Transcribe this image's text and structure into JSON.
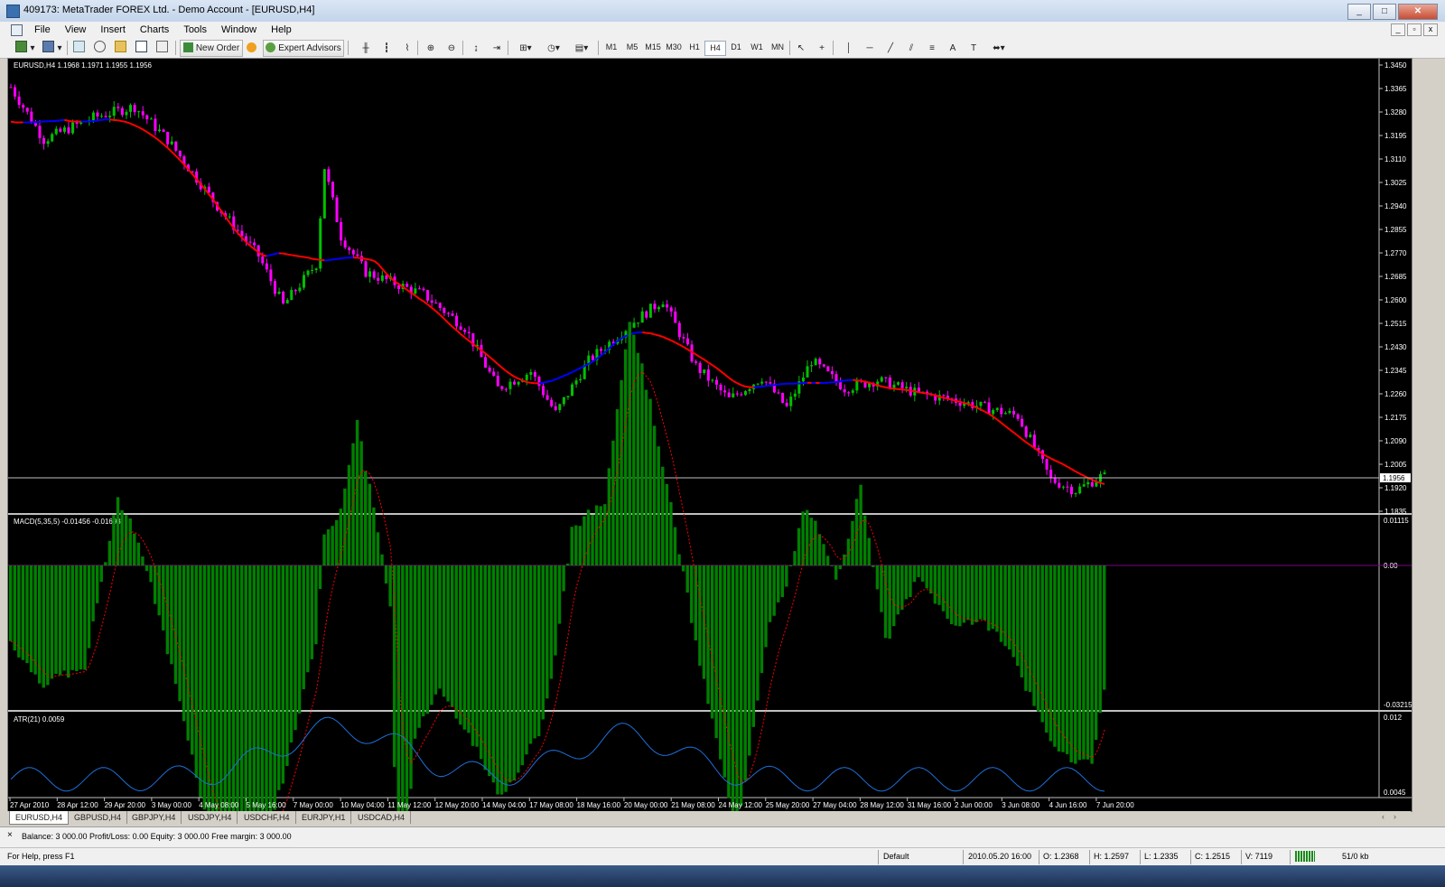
{
  "window": {
    "title": "409173: MetaTrader FOREX Ltd. - Demo Account - [EURUSD,H4]",
    "min": "_",
    "max": "□",
    "close": "✕"
  },
  "menu": [
    "File",
    "View",
    "Insert",
    "Charts",
    "Tools",
    "Window",
    "Help"
  ],
  "toolbar": {
    "new_order": "New Order",
    "expert_advisors": "Expert Advisors",
    "timeframes": [
      "M1",
      "M5",
      "M15",
      "M30",
      "H1",
      "H4",
      "D1",
      "W1",
      "MN"
    ],
    "selected_timeframe": "H4",
    "text_tool": "A",
    "label_tool": "T"
  },
  "chart": {
    "header": "EURUSD,H4  1.1968 1.1971 1.1955 1.1956",
    "price_axis": [
      "1.3450",
      "1.3365",
      "1.3280",
      "1.3195",
      "1.3110",
      "1.3025",
      "1.2940",
      "1.2855",
      "1.2770",
      "1.2685",
      "1.2600",
      "1.2515",
      "1.2430",
      "1.2345",
      "1.2260",
      "1.2175",
      "1.2090",
      "1.2005",
      "1.1920",
      "1.1835"
    ],
    "current_price": "1.1956",
    "time_axis": [
      "27 Apr 2010",
      "28 Apr 12:00",
      "29 Apr 20:00",
      "3 May 00:00",
      "4 May 08:00",
      "5 May 16:00",
      "7 May 00:00",
      "10 May 04:00",
      "11 May 12:00",
      "12 May 20:00",
      "14 May 04:00",
      "17 May 08:00",
      "18 May 16:00",
      "20 May 00:00",
      "21 May 08:00",
      "24 May 12:00",
      "25 May 20:00",
      "27 May 04:00",
      "28 May 12:00",
      "31 May 16:00",
      "2 Jun 00:00",
      "3 Jun 08:00",
      "4 Jun 16:00",
      "7 Jun 20:00"
    ]
  },
  "macd": {
    "label": "MACD(5,35,5) -0.01456 -0.01693",
    "axis_top": "0.01115",
    "axis_zero": "0.00",
    "axis_bottom": "-0.03215"
  },
  "atr": {
    "label": "ATR(21) 0.0059",
    "axis_top": "0.012",
    "axis_bottom": "0.0045"
  },
  "colors": {
    "bull": "#00c000",
    "bear": "#ff00ff",
    "ma_down": "#ff0000",
    "ma_up": "#0000ff",
    "macd_hist": "#008000",
    "macd_signal": "#ff0000",
    "atr": "#1e6fd9"
  },
  "tabs": [
    "EURUSD,H4",
    "GBPUSD,H4",
    "GBPJPY,H4",
    "USDJPY,H4",
    "USDCHF,H4",
    "EURJPY,H1",
    "USDCAD,H4"
  ],
  "terminal": {
    "close": "×",
    "account": "Balance: 3 000.00  Profit/Loss: 0.00  Equity: 3 000.00  Free margin: 3 000.00"
  },
  "status": {
    "help": "For Help, press F1",
    "profile": "Default",
    "time": "2010.05.20 16:00",
    "open": "O: 1.2368",
    "high": "H: 1.2597",
    "low": "L: 1.2335",
    "close": "C: 1.2515",
    "volume": "V: 7119",
    "traffic": "51/0 kb"
  }
}
